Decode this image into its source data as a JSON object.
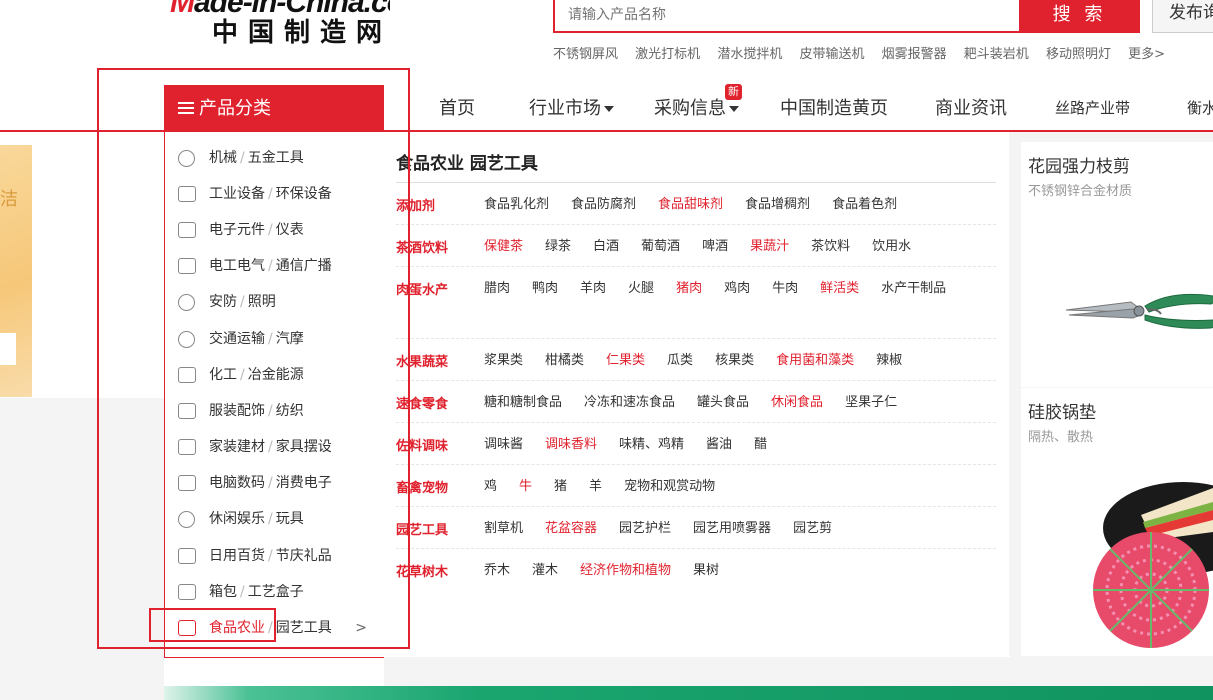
{
  "header": {
    "logo_en_prefix": "M",
    "logo_en_rest": "ade-in-China.com",
    "logo_cn": "中国制造网",
    "search_placeholder": "请输入产品名称",
    "search_button": "搜 索",
    "publish_button": "发布询",
    "hot_words": [
      "不锈钢屏风",
      "激光打标机",
      "潜水搅拌机",
      "皮带输送机",
      "烟雾报警器",
      "耙斗装岩机",
      "移动照明灯",
      "更多>"
    ]
  },
  "nav": {
    "category_header": "产品分类",
    "items": [
      "首页",
      "行业市场",
      "采购信息",
      "中国制造黄页",
      "商业资讯",
      "丝路产业带",
      "衡水"
    ],
    "new_badge": "新"
  },
  "left_banner": {
    "text": "洁"
  },
  "categories": [
    {
      "first": "机械",
      "second": "五金工具"
    },
    {
      "first": "工业设备",
      "second": "环保设备"
    },
    {
      "first": "电子元件",
      "second": "仪表"
    },
    {
      "first": "电工电气",
      "second": "通信广播"
    },
    {
      "first": "安防",
      "second": "照明"
    },
    {
      "first": "交通运输",
      "second": "汽摩"
    },
    {
      "first": "化工",
      "second": "冶金能源"
    },
    {
      "first": "服装配饰",
      "second": "纺织"
    },
    {
      "first": "家装建材",
      "second": "家具摆设"
    },
    {
      "first": "电脑数码",
      "second": "消费电子"
    },
    {
      "first": "休闲娱乐",
      "second": "玩具"
    },
    {
      "first": "日用百货",
      "second": "节庆礼品"
    },
    {
      "first": "箱包",
      "second": "工艺盒子"
    },
    {
      "first": "食品农业",
      "second": "园艺工具",
      "arrow": ">"
    }
  ],
  "panel": {
    "title": "食品农业 园艺工具",
    "rows": [
      {
        "label": "添加剂",
        "items": [
          "食品乳化剂",
          "食品防腐剂",
          "食品甜味剂",
          "食品增稠剂",
          "食品着色剂"
        ]
      },
      {
        "label": "茶酒饮料",
        "items": [
          "保健茶",
          "绿茶",
          "白酒",
          "葡萄酒",
          "啤酒",
          "果蔬汁",
          "茶饮料",
          "饮用水"
        ]
      },
      {
        "label": "肉蛋水产",
        "items": [
          "腊肉",
          "鸭肉",
          "羊肉",
          "火腿",
          "猪肉",
          "鸡肉",
          "牛肉",
          "鲜活类",
          "水产干制品"
        ]
      },
      {
        "label": "水果蔬菜",
        "items": [
          "浆果类",
          "柑橘类",
          "仁果类",
          "瓜类",
          "核果类",
          "食用菌和藻类",
          "辣椒"
        ]
      },
      {
        "label": "速食零食",
        "items": [
          "糖和糖制食品",
          "冷冻和速冻食品",
          "罐头食品",
          "休闲食品",
          "坚果子仁"
        ]
      },
      {
        "label": "佐料调味",
        "items": [
          "调味酱",
          "调味香料",
          "味精、鸡精",
          "酱油",
          "醋"
        ]
      },
      {
        "label": "畜禽宠物",
        "items": [
          "鸡",
          "牛",
          "猪",
          "羊",
          "宠物和观赏动物"
        ]
      },
      {
        "label": "园艺工具",
        "items": [
          "割草机",
          "花盆容器",
          "园艺护栏",
          "园艺用喷雾器",
          "园艺剪"
        ]
      },
      {
        "label": "花草树木",
        "items": [
          "乔木",
          "灌木",
          "经济作物和植物",
          "果树"
        ]
      }
    ],
    "highlight_color": "#e0222e"
  },
  "ads": [
    {
      "title": "花园强力枝剪",
      "subtitle": "不锈钢锌合金材质",
      "image": "pruning-shears"
    },
    {
      "title": "硅胶锅垫",
      "subtitle": "隔热、散热",
      "image": "silicone-pot-mat"
    }
  ],
  "colors": {
    "brand_red": "#e0222e"
  }
}
